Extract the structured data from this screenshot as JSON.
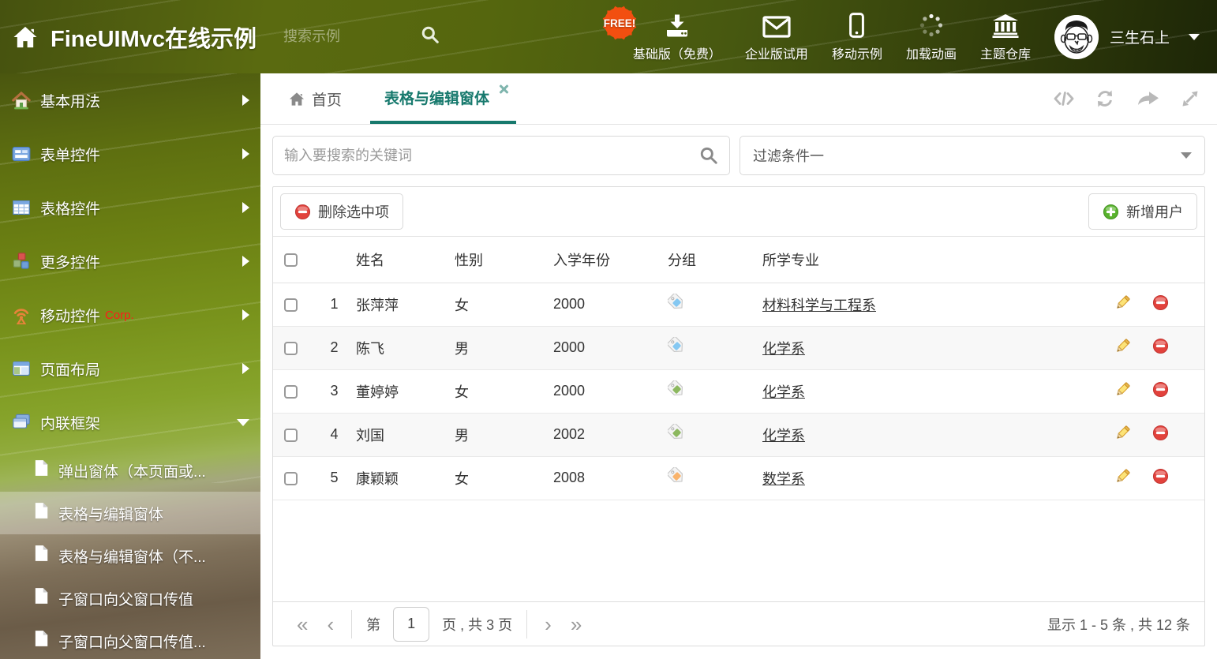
{
  "colors": {
    "accent_teal": "#17796d",
    "delete_red": "#e2423c",
    "add_green": "#58b22c",
    "tag_blue": "#85c8f2",
    "tag_green": "#8cb85f",
    "tag_orange": "#f9b36b"
  },
  "header": {
    "title": "FineUIMvc在线示例",
    "search_placeholder": "搜索示例",
    "free_badge": "FREE!",
    "nav": [
      {
        "label": "基础版（免费）"
      },
      {
        "label": "企业版试用"
      },
      {
        "label": "移动示例"
      },
      {
        "label": "加载动画"
      },
      {
        "label": "主题仓库"
      }
    ],
    "user_name": "三生石上"
  },
  "sidebar": {
    "items": [
      {
        "label": "基本用法"
      },
      {
        "label": "表单控件"
      },
      {
        "label": "表格控件"
      },
      {
        "label": "更多控件"
      },
      {
        "label": "移动控件",
        "badge": "Corp."
      },
      {
        "label": "页面布局"
      },
      {
        "label": "内联框架"
      }
    ],
    "subitems": [
      {
        "label": "弹出窗体（本页面或..."
      },
      {
        "label": "表格与编辑窗体"
      },
      {
        "label": "表格与编辑窗体（不..."
      },
      {
        "label": "子窗口向父窗口传值"
      },
      {
        "label": "子窗口向父窗口传值..."
      }
    ]
  },
  "tabs": {
    "home_label": "首页",
    "active_label": "表格与编辑窗体"
  },
  "filters": {
    "search_placeholder": "输入要搜索的关键词",
    "filter_value": "过滤条件一"
  },
  "toolbar": {
    "delete_label": "删除选中项",
    "add_label": "新增用户"
  },
  "table": {
    "columns": [
      "姓名",
      "性别",
      "入学年份",
      "分组",
      "所学专业"
    ],
    "rows": [
      {
        "num": "1",
        "name": "张萍萍",
        "gender": "女",
        "year": "2000",
        "tag_color": "#85c8f2",
        "major": "材料科学与工程系"
      },
      {
        "num": "2",
        "name": "陈飞",
        "gender": "男",
        "year": "2000",
        "tag_color": "#85c8f2",
        "major": "化学系"
      },
      {
        "num": "3",
        "name": "董婷婷",
        "gender": "女",
        "year": "2000",
        "tag_color": "#8cb85f",
        "major": "化学系"
      },
      {
        "num": "4",
        "name": "刘国",
        "gender": "男",
        "year": "2002",
        "tag_color": "#8cb85f",
        "major": "化学系"
      },
      {
        "num": "5",
        "name": "康颖颖",
        "gender": "女",
        "year": "2008",
        "tag_color": "#f9b36b",
        "major": "数学系"
      }
    ]
  },
  "pagination": {
    "page_prefix": "第",
    "page_value": "1",
    "page_suffix": "页 , 共 3 页",
    "summary": "显示 1 - 5 条 , 共 12 条"
  }
}
